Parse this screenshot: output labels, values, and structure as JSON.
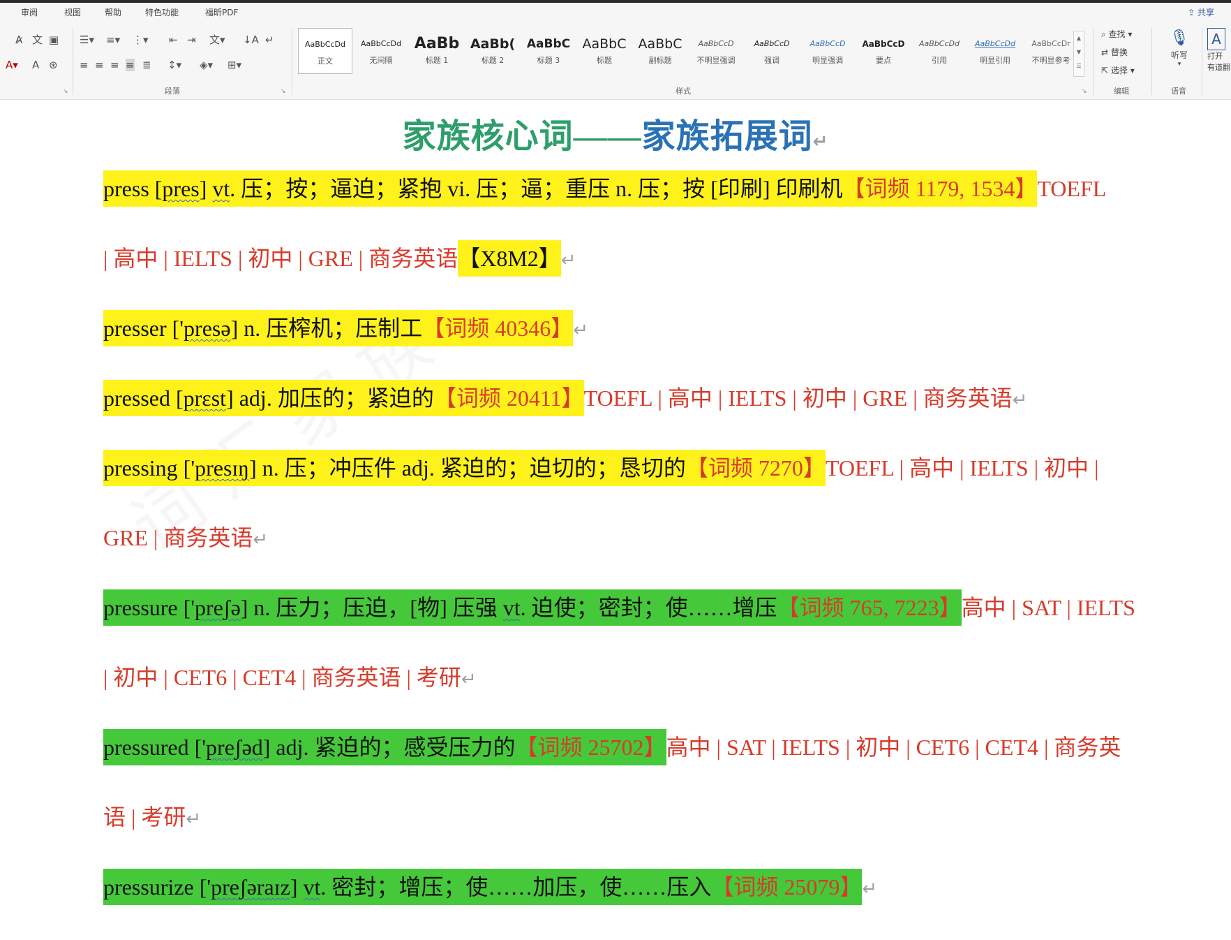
{
  "menu": {
    "tabs": [
      "审阅",
      "视图",
      "帮助",
      "特色功能",
      "福昕PDF"
    ],
    "share": "共享"
  },
  "ribbon": {
    "styles": [
      {
        "sample": "AaBbCcDd",
        "name": "正文"
      },
      {
        "sample": "AaBbCcDd",
        "name": "无间隔"
      },
      {
        "sample": "AaBb",
        "name": "标题 1"
      },
      {
        "sample": "AaBb(",
        "name": "标题 2"
      },
      {
        "sample": "AaBbC",
        "name": "标题 3"
      },
      {
        "sample": "AaBbC",
        "name": "标题"
      },
      {
        "sample": "AaBbC",
        "name": "副标题"
      },
      {
        "sample": "AaBbCcD",
        "name": "不明显强调"
      },
      {
        "sample": "AaBbCcD",
        "name": "强调"
      },
      {
        "sample": "AaBbCcD",
        "name": "明显强调"
      },
      {
        "sample": "AaBbCcD",
        "name": "要点"
      },
      {
        "sample": "AaBbCcDd",
        "name": "引用"
      },
      {
        "sample": "AaBbCcDd",
        "name": "明显引用"
      },
      {
        "sample": "AaBbCcDr",
        "name": "不明显参考"
      }
    ],
    "groups": {
      "paragraph": "段落",
      "styles": "样式",
      "editing": "编辑",
      "voice": "语音"
    },
    "editing": {
      "find": "查找",
      "replace": "替换",
      "select": "选择"
    },
    "voice": {
      "dictate": "听写"
    },
    "extra": {
      "label1": "打开",
      "label2": "有道翻"
    }
  },
  "document": {
    "title_part1": "家族核心词——",
    "title_part2": "家族拓展词",
    "entries": {
      "press": {
        "word": "press [",
        "ipa": "pres",
        "close": "] ",
        "pos1": "vt",
        "def": ". 压；按；逼迫；紧抱 vi. 压；逼；重压 n. 压；按 [印刷] 印刷机",
        "freq": "【词频 1179, 1534】",
        "tags_line1": "TOEFL",
        "tags_line2": "| 高中 | IELTS | 初中 | GRE | 商务英语",
        "code": "【X8M2】"
      },
      "presser": {
        "word": "presser ['",
        "ipa": "presə",
        "def": "] n. 压榨机；压制工",
        "freq": "【词频 40346】"
      },
      "pressed": {
        "word": "pressed [",
        "ipa": "prɛst",
        "def": "] adj. 加压的；紧迫的",
        "freq": "【词频 20411】",
        "tags": "TOEFL | 高中 | IELTS | 初中 | GRE | 商务英语"
      },
      "pressing": {
        "word": "pressing ['",
        "ipa": "presɪŋ",
        "def": "] n. 压；冲压件 adj. 紧迫的；迫切的；恳切的",
        "freq": "【词频 7270】",
        "tags_line1": "TOEFL | 高中 | IELTS | 初中 |",
        "tags_line2": "GRE | 商务英语"
      },
      "pressure": {
        "word": "pressure ['",
        "ipa": "preʃə",
        "def1": "] n. 压力；压迫，[物] 压强 ",
        "pos2": "vt",
        "def2": ". 迫使；密封；使……增压",
        "freq": "【词频 765, 7223】",
        "tags_line1": "高中 | SAT | IELTS",
        "tags_line2": "| 初中 | CET6 | CET4 | 商务英语 | 考研"
      },
      "pressured": {
        "word": "pressured ['",
        "ipa": "preʃəd",
        "def": "] adj. 紧迫的；感受压力的",
        "freq": "【词频 25702】",
        "tags_line1": "高中 | SAT | IELTS | 初中 | CET6 | CET4 | 商务英",
        "tags_line2": "语 | 考研"
      },
      "pressurize": {
        "word": "pressurize ['",
        "ipa": "preʃəraɪz",
        "mid": "] ",
        "pos": "vt",
        "def": ". 密封；增压；使……加压，使……压入",
        "freq": "【词频 25079】"
      }
    },
    "para_mark": "↵"
  },
  "colors": {
    "highlight_yellow": "#fff21a",
    "highlight_green": "#45c93a",
    "red_text": "#d83a2a",
    "title_green": "#2e9e6a",
    "title_blue": "#2a72b5"
  }
}
